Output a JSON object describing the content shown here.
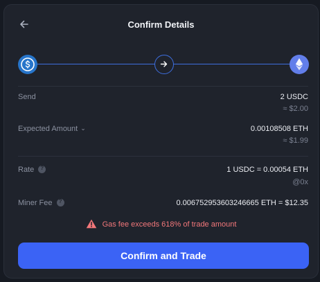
{
  "header": {
    "title": "Confirm Details",
    "back_icon": "arrow-left-icon"
  },
  "stepper": {
    "from_token_icon": "usdc-icon",
    "middle_icon": "arrow-right-icon",
    "to_token_icon": "eth-icon",
    "accent_color": "#3e6fe0"
  },
  "details": {
    "send": {
      "label": "Send",
      "value": "2 USDC",
      "sub": "≈ $2.00"
    },
    "expected": {
      "label": "Expected Amount",
      "value": "0.00108508 ETH",
      "sub": "≈ $1.99"
    },
    "rate": {
      "label": "Rate",
      "value": "1 USDC = 0.00054 ETH",
      "sub": "@0x"
    },
    "miner_fee": {
      "label": "Miner Fee",
      "value": "0.006752953603246665 ETH = $12.35"
    }
  },
  "warning": {
    "text": "Gas fee exceeds 618% of trade amount",
    "color": "#f2777a"
  },
  "confirm_button": {
    "label": "Confirm and Trade",
    "color": "#3b63f5"
  }
}
